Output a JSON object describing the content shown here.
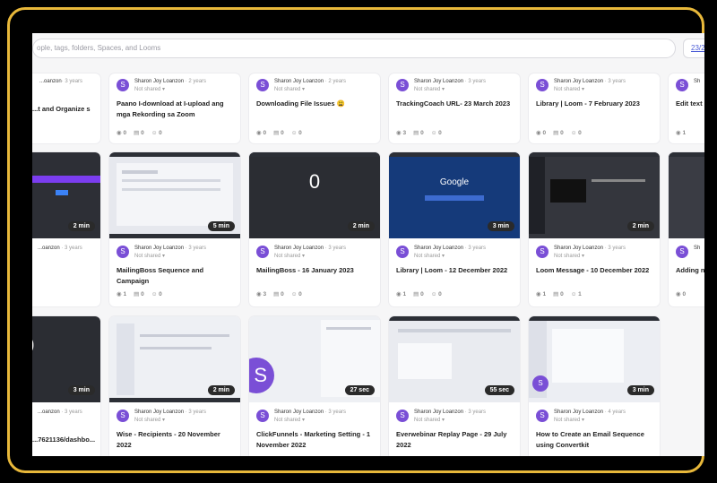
{
  "search": {
    "placeholder": "ople, tags, folders, Spaces, and Looms"
  },
  "tag_label": "23/2",
  "colors": {
    "frame": "#e8b83a",
    "avatar": "#7a4fd6",
    "search_tag": "#4a5bd6"
  },
  "cards": [
    {
      "avatar": "S",
      "author": "...oanzon",
      "age": "· 3 years",
      "shared": "",
      "title": "...t and Organize\ns",
      "views": "",
      "comments": "",
      "reactions": "",
      "duration": ""
    },
    {
      "avatar": "S",
      "author": "Sharon Joy Loanzon",
      "age": "· 2 years",
      "shared": "Not shared ▾",
      "title": "Paano I-download at I-upload ang mga Rekording sa Zoom",
      "views": "0",
      "comments": "0",
      "reactions": "0",
      "duration": ""
    },
    {
      "avatar": "S",
      "author": "Sharon Joy Loanzon",
      "age": "· 2 years",
      "shared": "Not shared ▾",
      "title": "Downloading File Issues 😩",
      "views": "0",
      "comments": "0",
      "reactions": "0",
      "duration": ""
    },
    {
      "avatar": "S",
      "author": "Sharon Joy Loanzon",
      "age": "· 3 years",
      "shared": "Not shared ▾",
      "title": "TrackingCoach URL- 23 March 2023",
      "views": "3",
      "comments": "0",
      "reactions": "0",
      "duration": ""
    },
    {
      "avatar": "S",
      "author": "Sharon Joy Loanzon",
      "age": "· 3 years",
      "shared": "Not shared ▾",
      "title": "Library | Loom - 7 February 2023",
      "views": "0",
      "comments": "0",
      "reactions": "0",
      "duration": ""
    },
    {
      "avatar": "S",
      "author": "Sh",
      "age": "",
      "shared": "",
      "title": "Edit text",
      "views": "1",
      "comments": "",
      "reactions": "",
      "duration": ""
    },
    {
      "avatar": "S",
      "author": "...oanzon",
      "age": "· 3 years",
      "shared": "",
      "title": "",
      "views": "",
      "comments": "",
      "reactions": "",
      "duration": "2 min"
    },
    {
      "avatar": "S",
      "author": "Sharon Joy Loanzon",
      "age": "· 3 years",
      "shared": "Not shared ▾",
      "title": "MailingBoss Sequence and Campaign",
      "views": "1",
      "comments": "0",
      "reactions": "0",
      "duration": "5 min"
    },
    {
      "avatar": "S",
      "author": "Sharon Joy Loanzon",
      "age": "· 3 years",
      "shared": "Not shared ▾",
      "title": "MailingBoss - 16 January 2023",
      "views": "3",
      "comments": "0",
      "reactions": "0",
      "duration": "2 min"
    },
    {
      "avatar": "S",
      "author": "Sharon Joy Loanzon",
      "age": "· 3 years",
      "shared": "Not shared ▾",
      "title": "Library | Loom - 12 December 2022",
      "views": "1",
      "comments": "0",
      "reactions": "0",
      "duration": "3 min"
    },
    {
      "avatar": "S",
      "author": "Sharon Joy Loanzon",
      "age": "· 3 years",
      "shared": "Not shared ▾",
      "title": "Loom Message - 10 December 2022",
      "views": "1",
      "comments": "0",
      "reactions": "1",
      "duration": "2 min"
    },
    {
      "avatar": "S",
      "author": "Sh",
      "age": "",
      "shared": "",
      "title": "Adding n",
      "views": "0",
      "comments": "",
      "reactions": "",
      "duration": ""
    },
    {
      "avatar": "S",
      "author": "...oanzon",
      "age": "· 3 years",
      "shared": "",
      "title": "...7621136/dashbo...",
      "views": "",
      "comments": "",
      "reactions": "",
      "duration": "3 min"
    },
    {
      "avatar": "S",
      "author": "Sharon Joy Loanzon",
      "age": "· 3 years",
      "shared": "Not shared ▾",
      "title": "Wise - Recipients - 20 November 2022",
      "views": "",
      "comments": "",
      "reactions": "",
      "duration": "2 min"
    },
    {
      "avatar": "S",
      "author": "Sharon Joy Loanzon",
      "age": "· 3 years",
      "shared": "Not shared ▾",
      "title": "ClickFunnels - Marketing Setting - 1 November 2022",
      "views": "",
      "comments": "",
      "reactions": "",
      "duration": "27 sec"
    },
    {
      "avatar": "S",
      "author": "Sharon Joy Loanzon",
      "age": "· 3 years",
      "shared": "Not shared ▾",
      "title": "Everwebinar Replay Page - 29 July 2022",
      "views": "",
      "comments": "",
      "reactions": "",
      "duration": "55 sec"
    },
    {
      "avatar": "S",
      "author": "Sharon Joy Loanzon",
      "age": "· 4 years",
      "shared": "Not shared ▾",
      "title": "How to Create an Email Sequence using Convertkit",
      "views": "",
      "comments": "",
      "reactions": "",
      "duration": "3 min"
    }
  ],
  "thumb_texts": {
    "zero": "0",
    "google": "Google"
  }
}
